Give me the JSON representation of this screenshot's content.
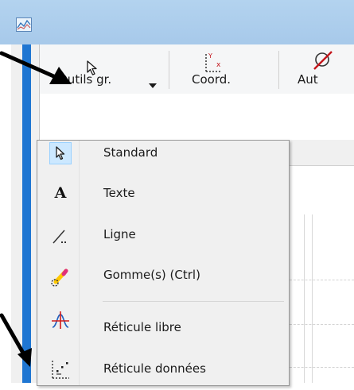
{
  "ribbon": {
    "outils_label": "Outils gr.",
    "coord_label": "Coord.",
    "auto_label": "Aut"
  },
  "menu": {
    "items": [
      {
        "label": "Standard",
        "icon": "cursor-arrow-icon",
        "selected": true
      },
      {
        "label": "Texte",
        "icon": "text-a-icon"
      },
      {
        "label": "Ligne",
        "icon": "line-icon"
      },
      {
        "label": "Gomme(s) (Ctrl)",
        "icon": "eraser-icon"
      },
      {
        "label": "Réticule libre",
        "icon": "free-crosshair-icon"
      },
      {
        "label": "Réticule données",
        "icon": "data-crosshair-icon"
      }
    ]
  },
  "colors": {
    "titlebar": "#a7c9ea",
    "sidebar_accent": "#1f76d2",
    "selection_fill": "#cce8ff",
    "annotation_arrow": "#000000"
  }
}
